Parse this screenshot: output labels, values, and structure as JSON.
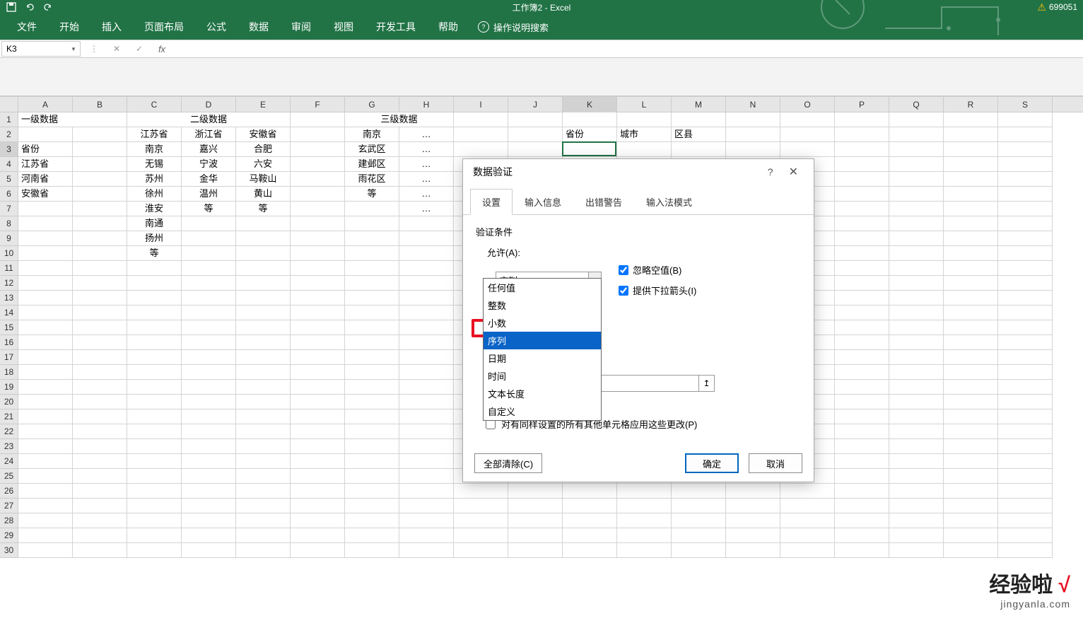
{
  "titlebar": {
    "title": "工作簿2 - Excel",
    "login_id": "699051"
  },
  "ribbon": {
    "tabs": [
      "文件",
      "开始",
      "插入",
      "页面布局",
      "公式",
      "数据",
      "审阅",
      "视图",
      "开发工具",
      "帮助"
    ],
    "tellme": "操作说明搜索"
  },
  "namebox": "K3",
  "columns": [
    "A",
    "B",
    "C",
    "D",
    "E",
    "F",
    "G",
    "H",
    "I",
    "J",
    "K",
    "L",
    "M",
    "N",
    "O",
    "P",
    "Q",
    "R",
    "S"
  ],
  "rows": [
    "1",
    "2",
    "3",
    "4",
    "5",
    "6",
    "7",
    "8",
    "9",
    "10",
    "11",
    "12",
    "13",
    "14",
    "15",
    "16",
    "17",
    "18",
    "19",
    "20",
    "21",
    "22",
    "23",
    "24",
    "25",
    "26",
    "27",
    "28",
    "29",
    "30"
  ],
  "sheet": {
    "r1": {
      "A": "一级数据",
      "CDE": "二级数据",
      "GH": "三级数据"
    },
    "r2": {
      "C": "江苏省",
      "D": "浙江省",
      "E": "安徽省",
      "G": "南京",
      "H": "…",
      "K": "省份",
      "L": "城市",
      "M": "区县"
    },
    "r3": {
      "A": "省份",
      "C": "南京",
      "D": "嘉兴",
      "E": "合肥",
      "G": "玄武区",
      "H": "…"
    },
    "r4": {
      "A": "江苏省",
      "C": "无锡",
      "D": "宁波",
      "E": "六安",
      "G": "建邺区",
      "H": "…"
    },
    "r5": {
      "A": "河南省",
      "C": "苏州",
      "D": "金华",
      "E": "马鞍山",
      "G": "雨花区",
      "H": "…"
    },
    "r6": {
      "A": "安徽省",
      "C": "徐州",
      "D": "温州",
      "E": "黄山",
      "G": "等",
      "H": "…"
    },
    "r7": {
      "C": "淮安",
      "D": "等",
      "E": "等",
      "H": "…"
    },
    "r8": {
      "C": "南通"
    },
    "r9": {
      "C": "扬州"
    },
    "r10": {
      "C": "等"
    }
  },
  "dialog": {
    "title": "数据验证",
    "tabs": [
      "设置",
      "输入信息",
      "出错警告",
      "输入法模式"
    ],
    "sec_label": "验证条件",
    "allow_label": "允许(A):",
    "allow_value": "序列",
    "ignore_blank": "忽略空值(B)",
    "dropdown_arrow": "提供下拉箭头(I)",
    "options": [
      "任何值",
      "整数",
      "小数",
      "序列",
      "日期",
      "时间",
      "文本长度",
      "自定义"
    ],
    "apply_all": "对有同样设置的所有其他单元格应用这些更改(P)",
    "clear": "全部清除(C)",
    "ok": "确定",
    "cancel": "取消"
  },
  "watermark": {
    "brand": "经验啦",
    "url": "jingyanla.com"
  }
}
